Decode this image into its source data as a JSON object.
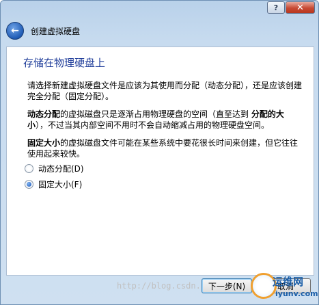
{
  "window": {
    "help_label": "?",
    "close_label": "✕"
  },
  "header": {
    "back_glyph": "←",
    "title": "创建虚拟硬盘"
  },
  "page": {
    "heading": "存储在物理硬盘上",
    "intro": "请选择新建虚拟硬盘文件是应该为其使用而分配（动态分配），还是应该创建完全分配（固定分配）。",
    "dynamic_bold": "动态分配",
    "dynamic_text_1": "的虚拟磁盘只是逐渐占用物理硬盘的空间（直至达到 ",
    "dynamic_bold_2": "分配的大小",
    "dynamic_text_2": "），不过当其内部空间不用时不会自动缩减占用的物理硬盘空间。",
    "fixed_bold": "固定大小",
    "fixed_text": "的虚拟磁盘文件可能在某些系统中要花很长时间来创建，但它往往使用起来较快。"
  },
  "options": [
    {
      "label": "动态分配(D)",
      "selected": false
    },
    {
      "label": "固定大小(F)",
      "selected": true
    }
  ],
  "buttons": {
    "next": "下一步(N)",
    "cancel": "取消"
  },
  "watermark": {
    "url_text": "http://blog.csdn.",
    "logo_text_1": "运维网",
    "logo_text_2": "iyunv.com"
  },
  "colors": {
    "heading": "#1f3d9a",
    "accent": "#1a56b8"
  }
}
